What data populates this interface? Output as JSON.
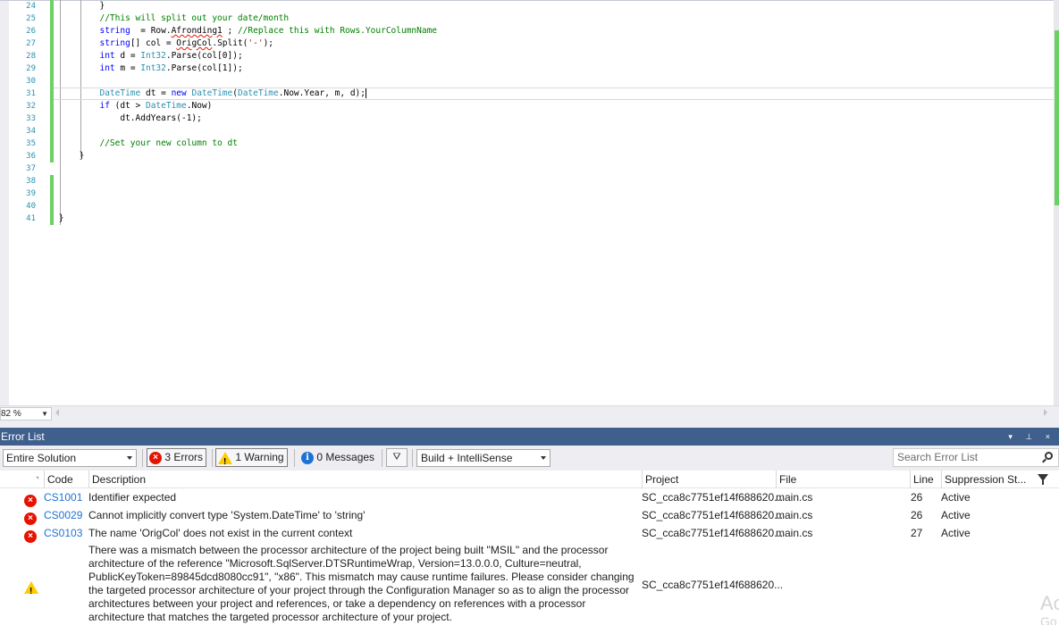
{
  "editor": {
    "line_numbers": [
      "24",
      "25",
      "26",
      "27",
      "28",
      "29",
      "30",
      "31",
      "32",
      "33",
      "34",
      "35",
      "36",
      "37",
      "38",
      "39",
      "40",
      "41"
    ],
    "code": {
      "l24": "}",
      "l25": "//This will split out your date/month",
      "l26_kw": "string",
      "l26_mid": "  = Row.",
      "l26_sq": "Afronding1",
      "l26_end": " ; ",
      "l26_cm": "//Replace this with Rows.YourColumnName",
      "l27_kw": "string",
      "l27_a": "[] col = ",
      "l27_sq": "OrigCol",
      "l27_b": ".Split(",
      "l27_str": "'-'",
      "l27_c": ");",
      "l28_kw": "int",
      "l28_a": " d = ",
      "l28_ty": "Int32",
      "l28_b": ".Parse(col[0]);",
      "l29_kw": "int",
      "l29_a": " m = ",
      "l29_ty": "Int32",
      "l29_b": ".Parse(col[1]);",
      "l31_ty1": "DateTime",
      "l31_a": " dt = ",
      "l31_kw": "new",
      "l31_ty2": "DateTime",
      "l31_b": "(",
      "l31_ty3": "DateTime",
      "l31_c": ".Now.Year, m, d);",
      "l32_kw": "if",
      "l32_a": " (dt > ",
      "l32_ty": "DateTime",
      "l32_b": ".Now)",
      "l33": "dt.AddYears(-1);",
      "l35": "//Set your new column to dt",
      "l36": "}",
      "l41": "}"
    }
  },
  "zoom": {
    "value": "82 %"
  },
  "error_list": {
    "title": "Error List",
    "title_icons": "▾ ⊥ ×",
    "scope": "Entire Solution",
    "errors_label": "3 Errors",
    "warnings_label": "1 Warning",
    "messages_label": "0 Messages",
    "build_filter": "Build + IntelliSense",
    "search_placeholder": "Search Error List",
    "columns": {
      "code": "Code",
      "description": "Description",
      "project": "Project",
      "file": "File",
      "line": "Line",
      "suppression": "Suppression St..."
    },
    "rows": [
      {
        "code": "CS1001",
        "description": "Identifier expected",
        "project": "SC_cca8c7751ef14f688620...",
        "file": "main.cs",
        "line": "26",
        "suppression": "Active"
      },
      {
        "code": "CS0029",
        "description": "Cannot implicitly convert type 'System.DateTime' to 'string'",
        "project": "SC_cca8c7751ef14f688620...",
        "file": "main.cs",
        "line": "26",
        "suppression": "Active"
      },
      {
        "code": "CS0103",
        "description": "The name 'OrigCol' does not exist in the current context",
        "project": "SC_cca8c7751ef14f688620...",
        "file": "main.cs",
        "line": "27",
        "suppression": "Active"
      },
      {
        "code": "",
        "description": "There was a mismatch between the processor architecture of the project being built \"MSIL\" and the processor architecture of the reference \"Microsoft.SqlServer.DTSRuntimeWrap, Version=13.0.0.0, Culture=neutral, PublicKeyToken=89845dcd8080cc91\", \"x86\". This mismatch may cause runtime failures. Please consider changing the targeted processor architecture of your project through the Configuration Manager so as to align the processor architectures between your project and references, or take a dependency on references with a processor architecture that matches the targeted processor architecture of your project.",
        "project": "SC_cca8c7751ef14f688620...",
        "file": "",
        "line": "",
        "suppression": ""
      }
    ]
  },
  "watermark": {
    "line1": "Ac",
    "line2": "Go"
  },
  "colors": {
    "accent": "#3f5f8c",
    "error": "#e51400",
    "warning": "#ffcc00",
    "info": "#1e73d2",
    "change_bar": "#6cd164"
  }
}
